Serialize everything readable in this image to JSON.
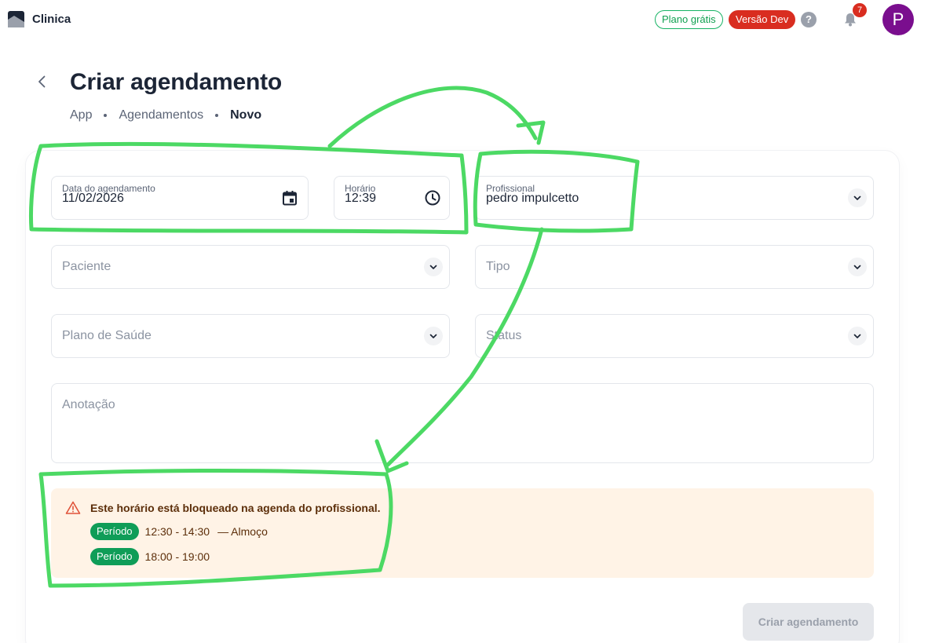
{
  "app": {
    "name": "Clinica"
  },
  "topbar": {
    "plan_badge": "Plano grátis",
    "dev_badge": "Versão Dev",
    "help": "?",
    "notifications_count": "7",
    "avatar_initial": "P"
  },
  "page": {
    "title": "Criar agendamento",
    "breadcrumb": [
      "App",
      "Agendamentos",
      "Novo"
    ]
  },
  "form": {
    "date": {
      "label": "Data do agendamento",
      "value": "11/02/2026"
    },
    "time": {
      "label": "Horário",
      "value": "12:39"
    },
    "professional": {
      "label": "Profissional",
      "value": "pedro impulcetto"
    },
    "patient": {
      "placeholder": "Paciente"
    },
    "type": {
      "placeholder": "Tipo"
    },
    "health_plan": {
      "placeholder": "Plano de Saúde"
    },
    "status": {
      "placeholder": "Status"
    },
    "note": {
      "placeholder": "Anotação"
    }
  },
  "alert": {
    "message": "Este horário está bloqueado na agenda do profissional.",
    "periods": [
      {
        "chip": "Período",
        "range": "12:30 - 14:30",
        "note": "— Almoço"
      },
      {
        "chip": "Período",
        "range": "18:00 - 19:00"
      }
    ]
  },
  "submit_label": "Criar agendamento",
  "colors": {
    "success": "#0f9d58",
    "danger": "#d92d20",
    "avatar": "#7a0e8e",
    "annotation": "#4cd964",
    "alert_bg": "#fff3e6"
  }
}
